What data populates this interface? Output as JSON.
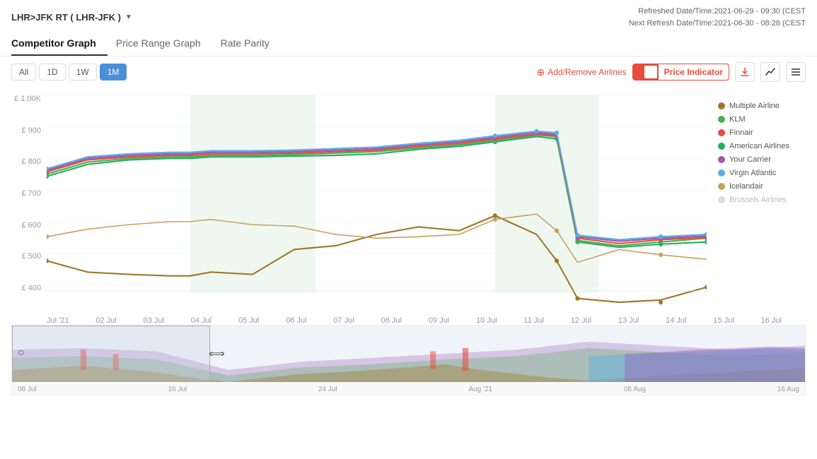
{
  "header": {
    "route": "LHR>JFK RT ( LHR-JFK )",
    "chevron": "▼",
    "refreshed_label": "Refreshed Date/Time:",
    "refreshed_value": "2021-06-29 - 09:30 (CEST",
    "next_refresh_label": "Next Refresh Date/Time:",
    "next_refresh_value": "2021-06-30 - 08:28 (CEST"
  },
  "tabs": [
    {
      "label": "Competitor Graph",
      "active": true
    },
    {
      "label": "Price Range Graph",
      "active": false
    },
    {
      "label": "Rate Parity",
      "active": false
    }
  ],
  "toolbar": {
    "time_filters": [
      "All",
      "1D",
      "1W",
      "1M"
    ],
    "active_filter": "1M",
    "add_remove_label": "Add/Remove Airlines",
    "price_indicator_label": "Price Indicator"
  },
  "y_axis": {
    "labels": [
      "£ 1.00K",
      "£ 900",
      "£ 800",
      "£ 700",
      "£ 600",
      "£ 500",
      "£ 400"
    ]
  },
  "x_axis": {
    "labels": [
      "Jul '21",
      "02 Jul",
      "03 Jul",
      "04 Jul",
      "05 Jul",
      "06 Jul",
      "07 Jul",
      "08 Jul",
      "09 Jul",
      "10 Jul",
      "11 Jul",
      "12 Jul",
      "13 Jul",
      "14 Jul",
      "15 Jul",
      "16 Jul"
    ]
  },
  "legend": {
    "items": [
      {
        "label": "Multiple Airline",
        "color": "#a0772a",
        "faded": false
      },
      {
        "label": "KLM",
        "color": "#4caf50",
        "faded": false
      },
      {
        "label": "Finnair",
        "color": "#e74c3c",
        "faded": false
      },
      {
        "label": "American Airlines",
        "color": "#27ae60",
        "faded": false
      },
      {
        "label": "Your Carrier",
        "color": "#9b59b6",
        "faded": false
      },
      {
        "label": "Virgin Atlantic",
        "color": "#3498db",
        "faded": false
      },
      {
        "label": "Icelandair",
        "color": "#c0a060",
        "faded": false
      },
      {
        "label": "Brussels Airlines",
        "color": "#ccc",
        "faded": true
      }
    ]
  },
  "mini_x_axis": {
    "labels": [
      "08 Jul",
      "16 Jul",
      "24 Jul",
      "Aug '21",
      "08 Aug",
      "16 Aug"
    ]
  }
}
